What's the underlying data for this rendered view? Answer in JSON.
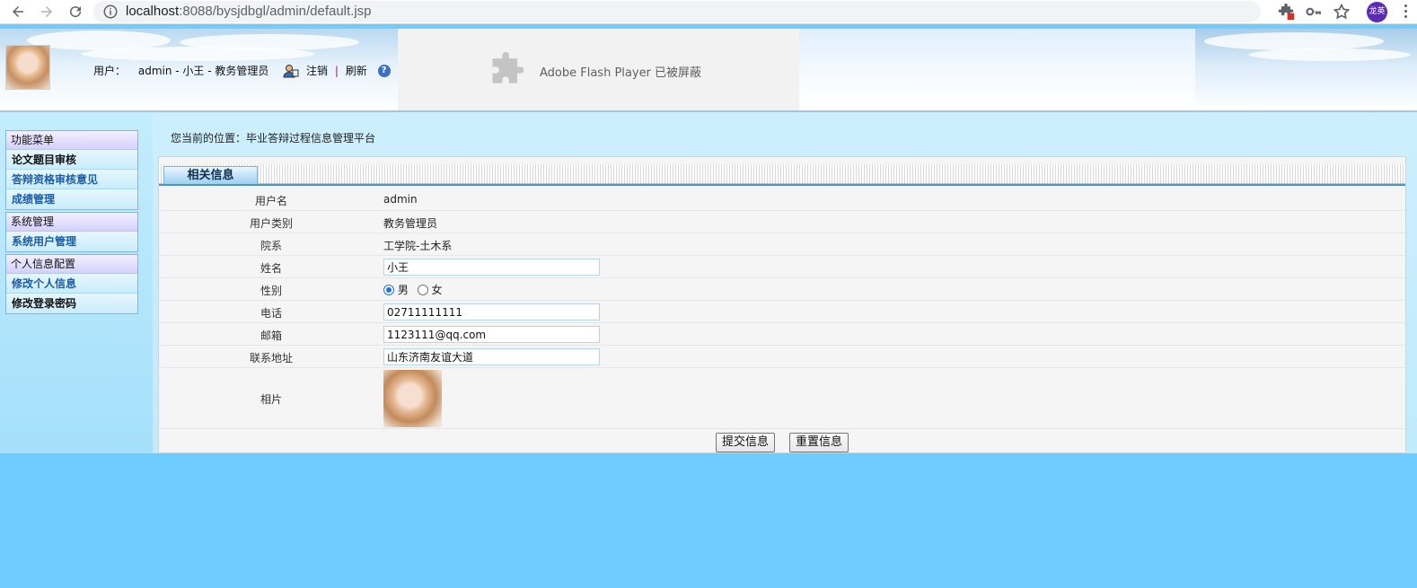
{
  "browser": {
    "url_host": "localhost",
    "url_rest": ":8088/bysjdbgl/admin/default.jsp",
    "profile_initials": "龙英"
  },
  "header": {
    "user_label": "用户：",
    "user_value": "admin - 小王 - 教务管理员",
    "logout": "注销",
    "separator": "|",
    "refresh": "刷新",
    "flash_message": "Adobe Flash Player 已被屏蔽"
  },
  "sidebar": {
    "groups": [
      {
        "title": "功能菜单",
        "items": [
          "论文题目审核",
          "答辩资格审核意见",
          "成绩管理"
        ]
      },
      {
        "title": "系统管理",
        "items": [
          "系统用户管理"
        ]
      },
      {
        "title": "个人信息配置",
        "items": [
          "修改个人信息",
          "修改登录密码"
        ]
      }
    ]
  },
  "breadcrumb": "您当前的位置：毕业答辩过程信息管理平台",
  "panel": {
    "tab_label": "相关信息",
    "fields": {
      "username": {
        "label": "用户名",
        "value": "admin"
      },
      "user_type": {
        "label": "用户类别",
        "value": "教务管理员"
      },
      "department": {
        "label": "院系",
        "value": "工学院-土木系"
      },
      "name": {
        "label": "姓名",
        "value": "小王"
      },
      "gender": {
        "label": "性别",
        "male": "男",
        "female": "女",
        "selected": "男"
      },
      "phone": {
        "label": "电话",
        "value": "02711111111"
      },
      "email": {
        "label": "邮箱",
        "value": "1123111@qq.com"
      },
      "address": {
        "label": "联系地址",
        "value": "山东济南友谊大道"
      },
      "photo": {
        "label": "相片"
      }
    },
    "submit_label": "提交信息",
    "reset_label": "重置信息"
  }
}
